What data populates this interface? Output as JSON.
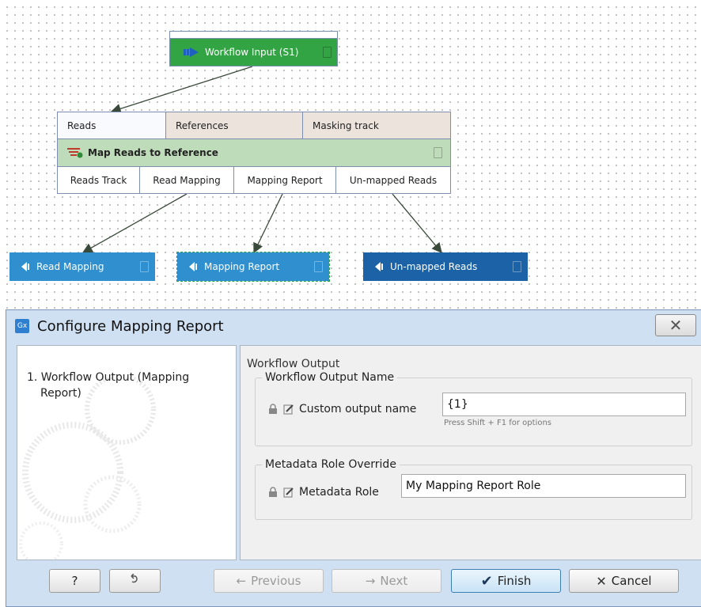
{
  "workflow": {
    "input_node": {
      "label": "Workflow Input (S1)",
      "color": "#33a444"
    },
    "mapper": {
      "inputs": [
        "Reads",
        "References",
        "Masking track"
      ],
      "title": "Map Reads to Reference",
      "outputs": [
        "Reads Track",
        "Read Mapping",
        "Mapping Report",
        "Un-mapped Reads"
      ]
    },
    "output_nodes": [
      {
        "label": "Read Mapping",
        "color": "#2f8fcf",
        "selected": false
      },
      {
        "label": "Mapping Report",
        "color": "#2f8fcf",
        "selected": true
      },
      {
        "label": "Un-mapped Reads",
        "color": "#1b63a6",
        "selected": false
      }
    ]
  },
  "dialog": {
    "logo_text": "Gx",
    "title": "Configure Mapping Report",
    "close_icon": "close-icon",
    "steps": [
      "1.  Workflow Output (Mapping",
      "Report)"
    ],
    "section_title": "Workflow Output",
    "output_name_group": {
      "legend": "Workflow Output Name",
      "field_label": "Custom output name",
      "value": "{1}",
      "hint": "Press Shift + F1 for options"
    },
    "metadata_group": {
      "legend": "Metadata Role Override",
      "field_label": "Metadata Role",
      "value": "My Mapping Report Role"
    },
    "buttons": {
      "help": "?",
      "reset_icon": "reset-icon",
      "previous": "Previous",
      "next": "Next",
      "finish": "Finish",
      "cancel": "Cancel"
    }
  }
}
